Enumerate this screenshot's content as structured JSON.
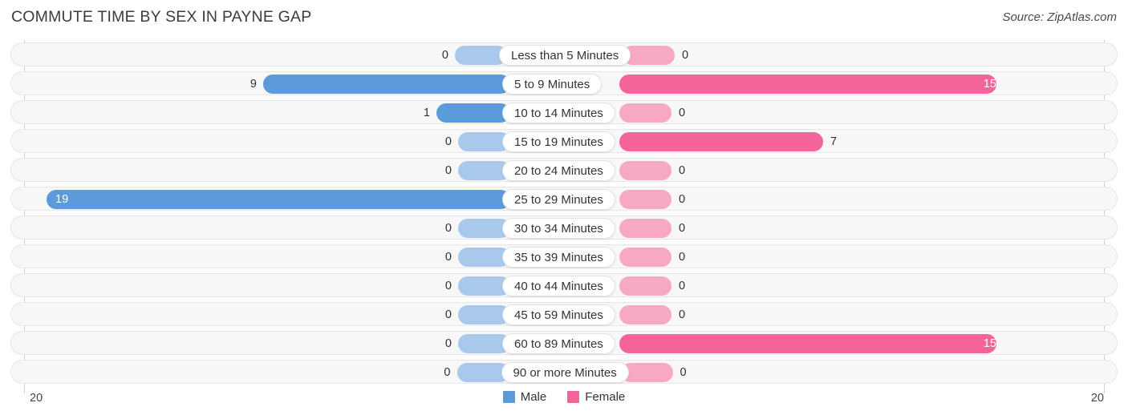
{
  "header": {
    "title": "COMMUTE TIME BY SEX IN PAYNE GAP",
    "source": "Source: ZipAtlas.com"
  },
  "legend": {
    "items": [
      {
        "label": "Male",
        "color": "#5b9bd9"
      },
      {
        "label": "Female",
        "color": "#f2649a"
      }
    ]
  },
  "axis": {
    "left_label": "20",
    "right_label": "20"
  },
  "colors": {
    "male_strong": "#5b9bd9",
    "male_light": "#a8c9ec",
    "female_strong": "#f2649a",
    "female_light": "#f7a8c4",
    "track": "#f7f7f7",
    "track_border": "#e6e6e6"
  },
  "chart_data": {
    "type": "bar",
    "orientation": "diverging-horizontal",
    "title": "COMMUTE TIME BY SEX IN PAYNE GAP",
    "xlabel": "",
    "ylabel": "",
    "xlim": [
      20,
      20
    ],
    "grid": false,
    "legend_position": "bottom-center",
    "categories": [
      "Less than 5 Minutes",
      "5 to 9 Minutes",
      "10 to 14 Minutes",
      "15 to 19 Minutes",
      "20 to 24 Minutes",
      "25 to 29 Minutes",
      "30 to 34 Minutes",
      "35 to 39 Minutes",
      "40 to 44 Minutes",
      "45 to 59 Minutes",
      "60 to 89 Minutes",
      "90 or more Minutes"
    ],
    "series": [
      {
        "name": "Male",
        "color": "#5b9bd9",
        "values": [
          0,
          9,
          1,
          0,
          0,
          19,
          0,
          0,
          0,
          0,
          0,
          0
        ]
      },
      {
        "name": "Female",
        "color": "#f2649a",
        "values": [
          0,
          15,
          0,
          7,
          0,
          0,
          0,
          0,
          0,
          0,
          15,
          0
        ]
      }
    ]
  },
  "rows": [
    {
      "label": "Less than 5 Minutes",
      "male": "0",
      "female": "0"
    },
    {
      "label": "5 to 9 Minutes",
      "male": "9",
      "female": "15"
    },
    {
      "label": "10 to 14 Minutes",
      "male": "1",
      "female": "0"
    },
    {
      "label": "15 to 19 Minutes",
      "male": "0",
      "female": "7"
    },
    {
      "label": "20 to 24 Minutes",
      "male": "0",
      "female": "0"
    },
    {
      "label": "25 to 29 Minutes",
      "male": "19",
      "female": "0"
    },
    {
      "label": "30 to 34 Minutes",
      "male": "0",
      "female": "0"
    },
    {
      "label": "35 to 39 Minutes",
      "male": "0",
      "female": "0"
    },
    {
      "label": "40 to 44 Minutes",
      "male": "0",
      "female": "0"
    },
    {
      "label": "45 to 59 Minutes",
      "male": "0",
      "female": "0"
    },
    {
      "label": "60 to 89 Minutes",
      "male": "0",
      "female": "15"
    },
    {
      "label": "90 or more Minutes",
      "male": "0",
      "female": "0"
    }
  ]
}
